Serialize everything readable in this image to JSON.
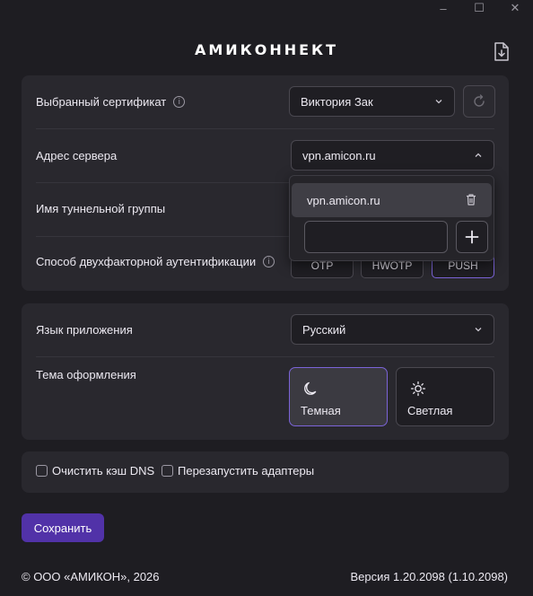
{
  "window": {
    "minimize_glyph": "–",
    "maximize_glyph": "☐",
    "close_glyph": "✕"
  },
  "brand": {
    "title": "АМИКОННЕКТ"
  },
  "connection": {
    "certificate": {
      "label": "Выбранный сертификат",
      "value": "Виктория Зак"
    },
    "server": {
      "label": "Адрес сервера",
      "value": "vpn.amicon.ru",
      "dropdown_open": true,
      "options": [
        "vpn.amicon.ru"
      ],
      "new_value": ""
    },
    "tunnel_group": {
      "label": "Имя туннельной группы"
    },
    "two_factor": {
      "label": "Способ двухфакторной аутентификации",
      "options": [
        "OTP",
        "HWOTP",
        "PUSH"
      ],
      "selected": "PUSH"
    }
  },
  "appearance": {
    "language": {
      "label": "Язык приложения",
      "value": "Русский"
    },
    "theme": {
      "label": "Тема оформления",
      "options": [
        {
          "label": "Темная",
          "icon": "moon-icon",
          "active": true
        },
        {
          "label": "Светлая",
          "icon": "sun-icon",
          "active": false
        }
      ]
    }
  },
  "maintenance": {
    "clear_dns": {
      "label": "Очистить кэш DNS",
      "checked": false
    },
    "restart_adapters": {
      "label": "Перезапустить адаптеры",
      "checked": false
    }
  },
  "actions": {
    "save_label": "Сохранить"
  },
  "footer": {
    "copyright": "© ООО «АМИКОН», 2026",
    "version": "Версия 1.20.2098 (1.10.2098)"
  },
  "colors": {
    "background": "#1e1d22",
    "card": "#29282e",
    "accent": "#5132a8",
    "accent_border": "#7b64d8"
  }
}
